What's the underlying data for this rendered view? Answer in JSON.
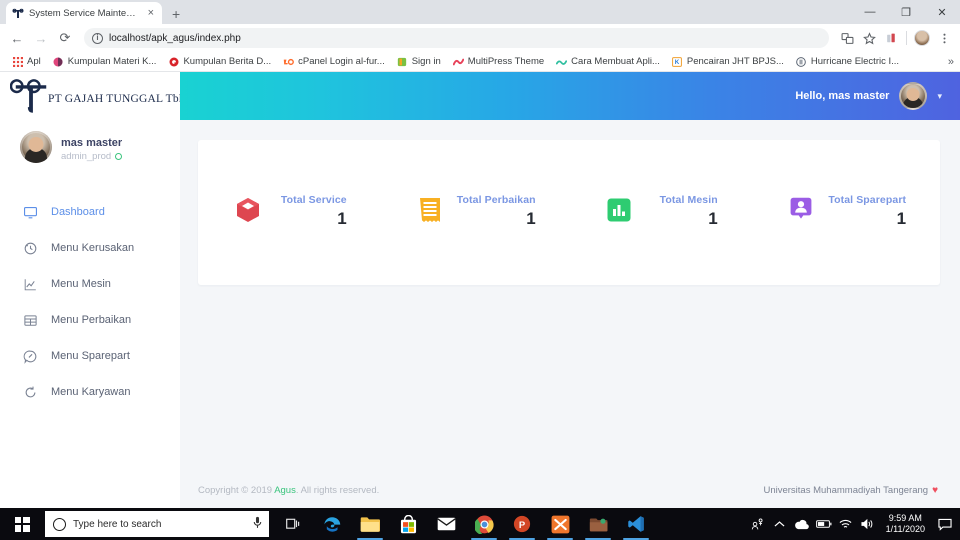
{
  "browser": {
    "tab": {
      "title": "System Service Maintenance",
      "favicon": "gt-logo-favicon",
      "close": "×"
    },
    "newtab_label": "+",
    "window_controls": {
      "minimize": "—",
      "maximize": "❐",
      "close": "✕"
    },
    "nav": {
      "back": "←",
      "forward": "→",
      "reload": "⟳"
    },
    "omnibox": {
      "info_icon": "i",
      "url": "localhost/apk_agus/index.php"
    },
    "toolbar_icons": [
      "translate-icon",
      "bookmark-star-icon",
      "extension-icon",
      "profile-avatar",
      "chrome-menu-icon"
    ],
    "bookmarks": [
      {
        "label": "Apl",
        "icon": "apps-grid-icon",
        "color": "#e8453c"
      },
      {
        "label": "Kumpulan Materi K...",
        "icon": "site-icon",
        "color": "#e0457b"
      },
      {
        "label": "Kumpulan Berita D...",
        "icon": "site-icon",
        "color": "#d8232a"
      },
      {
        "label": "cPanel Login al-fur...",
        "icon": "cpanel-icon",
        "color": "#ff6c2c"
      },
      {
        "label": "Sign in",
        "icon": "site-icon",
        "color": "#7ac143"
      },
      {
        "label": "MultiPress Theme",
        "icon": "site-icon",
        "color": "#e8425a"
      },
      {
        "label": "Cara Membuat Apli...",
        "icon": "site-icon",
        "color": "#2fbfa0"
      },
      {
        "label": "Pencairan JHT BPJS...",
        "icon": "site-icon",
        "color": "#2f7fd8"
      },
      {
        "label": "Hurricane Electric I...",
        "icon": "site-icon",
        "color": "#5a6472"
      }
    ],
    "bookmarks_overflow": "»"
  },
  "sidebar": {
    "logo": {
      "text": "PT GAJAH TUNGGAL Tbk",
      "mark": "gt-monogram"
    },
    "profile": {
      "name": "mas master",
      "role": "admin_prod",
      "status": "online"
    },
    "items": [
      {
        "label": "Dashboard",
        "icon": "monitor-icon",
        "active": true
      },
      {
        "label": "Menu Kerusakan",
        "icon": "history-icon",
        "active": false
      },
      {
        "label": "Menu Mesin",
        "icon": "line-chart-icon",
        "active": false
      },
      {
        "label": "Menu Perbaikan",
        "icon": "table-icon",
        "active": false
      },
      {
        "label": "Menu Sparepart",
        "icon": "tag-icon",
        "active": false
      },
      {
        "label": "Menu Karyawan",
        "icon": "refresh-icon",
        "active": false
      }
    ]
  },
  "topbar": {
    "greeting": "Hello, mas master",
    "avatar": "user-avatar",
    "caret": "▾",
    "gradient_from": "#19d2d2",
    "gradient_to": "#4f63e0"
  },
  "stats": [
    {
      "label": "Total Service",
      "value": "1",
      "icon": "box-3d-icon",
      "color": "#e0454f"
    },
    {
      "label": "Total Perbaikan",
      "value": "1",
      "icon": "receipt-icon",
      "color": "#f7b024"
    },
    {
      "label": "Total Mesin",
      "value": "1",
      "icon": "bar-chart-icon",
      "color": "#2ecc71"
    },
    {
      "label": "Total Sparepart",
      "value": "1",
      "icon": "user-pin-icon",
      "color": "#9b5de5"
    }
  ],
  "footer": {
    "copyright_prefix": "Copyright © 2019 ",
    "copyright_author": "Agus",
    "copyright_suffix": ". All rights reserved.",
    "university": "Universitas Muhammadiyah Tangerang",
    "heart": "♥"
  },
  "taskbar": {
    "start": "windows-start-icon",
    "search_placeholder": "Type here to search",
    "mic": "🎤",
    "apps": [
      {
        "name": "task-view-icon",
        "open": false
      },
      {
        "name": "microsoft-edge-icon",
        "open": false
      },
      {
        "name": "file-explorer-icon",
        "open": true
      },
      {
        "name": "microsoft-store-icon",
        "open": false
      },
      {
        "name": "mail-icon",
        "open": false
      },
      {
        "name": "google-chrome-icon",
        "open": true
      },
      {
        "name": "powerpoint-icon",
        "open": true
      },
      {
        "name": "xampp-icon",
        "open": true
      },
      {
        "name": "package-folder-icon",
        "open": true
      },
      {
        "name": "vs-code-icon",
        "open": true
      }
    ],
    "tray": [
      "people-share-icon",
      "show-hidden-icon",
      "onedrive-icon",
      "battery-icon",
      "wifi-icon",
      "volume-icon"
    ],
    "time": "9:59 AM",
    "date": "1/11/2020",
    "action_center": "notification-icon"
  }
}
